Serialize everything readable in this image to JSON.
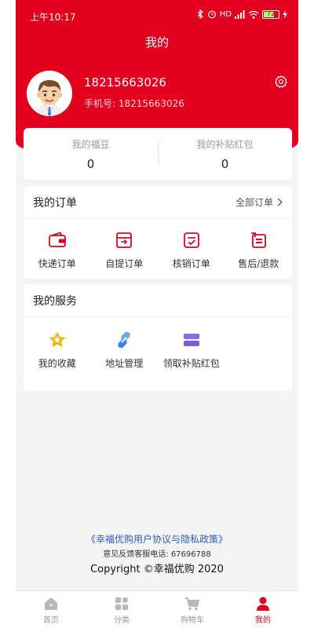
{
  "status_bar": {
    "time": "上午10:17",
    "network": "HD",
    "battery": "72"
  },
  "nav": {
    "title": "我的"
  },
  "profile": {
    "name": "18215663026",
    "phone_label": "手机号:",
    "phone": "18215663026"
  },
  "stats": [
    {
      "label": "我的福豆",
      "value": "0"
    },
    {
      "label": "我的补贴红包",
      "value": "0"
    }
  ],
  "orders": {
    "title": "我的订单",
    "more_label": "全部订单",
    "items": [
      {
        "label": "快递订单",
        "icon": "wallet-icon"
      },
      {
        "label": "自提订单",
        "icon": "pickup-box-icon"
      },
      {
        "label": "核销订单",
        "icon": "verify-check-icon"
      },
      {
        "label": "售后/退款",
        "icon": "refund-icon"
      }
    ]
  },
  "services": {
    "title": "我的服务",
    "items": [
      {
        "label": "我的收藏",
        "icon": "star-icon"
      },
      {
        "label": "地址管理",
        "icon": "link-icon"
      },
      {
        "label": "领取补贴红包",
        "icon": "coupon-stack-icon"
      }
    ]
  },
  "footer": {
    "agreement": "《幸福优购用户协议与隐私政策》",
    "hotline": "意见反馈客服电话: 67696788",
    "copyright": "Copyright ©幸福优购 2020"
  },
  "tabbar": [
    {
      "label": "首页",
      "icon": "home-icon",
      "active": false
    },
    {
      "label": "分类",
      "icon": "category-icon",
      "active": false
    },
    {
      "label": "购物车",
      "icon": "cart-icon",
      "active": false
    },
    {
      "label": "我的",
      "icon": "user-icon",
      "active": true
    }
  ],
  "colors": {
    "brand": "#e3001e",
    "link": "#2a5bd7",
    "battery": "#c6f26b"
  }
}
